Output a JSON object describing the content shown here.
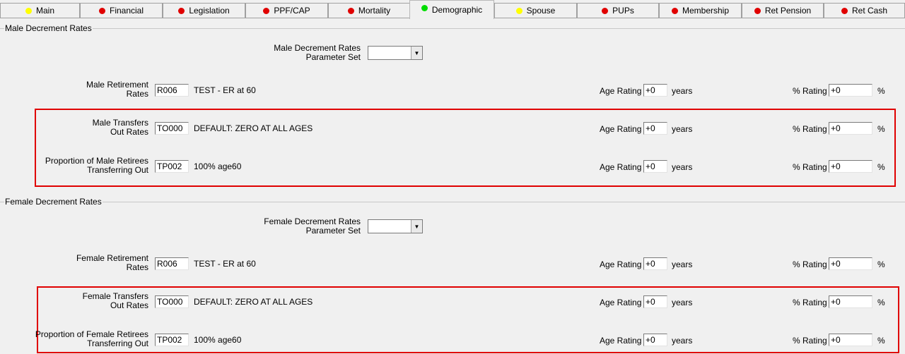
{
  "tabs": [
    {
      "label": "Main",
      "color": "#ffff00"
    },
    {
      "label": "Financial",
      "color": "#e00000"
    },
    {
      "label": "Legislation",
      "color": "#e00000"
    },
    {
      "label": "PPF/CAP",
      "color": "#e00000"
    },
    {
      "label": "Mortality",
      "color": "#e00000"
    },
    {
      "label": "Demographic",
      "color": "#00dd00"
    },
    {
      "label": "Spouse",
      "color": "#ffff00"
    },
    {
      "label": "PUPs",
      "color": "#e00000"
    },
    {
      "label": "Membership",
      "color": "#e00000"
    },
    {
      "label": "Ret Pension",
      "color": "#e00000"
    },
    {
      "label": "Ret Cash",
      "color": "#e00000"
    }
  ],
  "male": {
    "legend": "Male Decrement Rates",
    "param_label_1": "Male Decrement Rates",
    "param_label_2": "Parameter Set",
    "param_value": "",
    "rows": [
      {
        "label1": "Male Retirement",
        "label2": "Rates",
        "code": "R006",
        "desc": "TEST - ER at 60",
        "age_label": "Age Rating",
        "age_value": "+0",
        "age_unit": "years",
        "pct_label": "% Rating",
        "pct_value": "+0",
        "pct_unit": "%"
      },
      {
        "label1": "Male Transfers",
        "label2": "Out Rates",
        "code": "TO000",
        "desc": "DEFAULT:  ZERO AT ALL AGES",
        "age_label": "Age Rating",
        "age_value": "+0",
        "age_unit": "years",
        "pct_label": "% Rating",
        "pct_value": "+0",
        "pct_unit": "%"
      },
      {
        "label1": "Proportion of Male Retirees",
        "label2": "Transferring Out",
        "code": "TP002",
        "desc": "100% age60",
        "age_label": "Age Rating",
        "age_value": "+0",
        "age_unit": "years",
        "pct_label": "% Rating",
        "pct_value": "+0",
        "pct_unit": "%"
      }
    ]
  },
  "female": {
    "legend": "Female Decrement Rates",
    "param_label_1": "Female Decrement Rates",
    "param_label_2": "Parameter Set",
    "param_value": "",
    "rows": [
      {
        "label1": "Female Retirement",
        "label2": "Rates",
        "code": "R006",
        "desc": "TEST - ER at 60",
        "age_label": "Age Rating",
        "age_value": "+0",
        "age_unit": "years",
        "pct_label": "% Rating",
        "pct_value": "+0",
        "pct_unit": "%"
      },
      {
        "label1": "Female Transfers",
        "label2": "Out Rates",
        "code": "TO000",
        "desc": "DEFAULT:  ZERO AT ALL AGES",
        "age_label": "Age Rating",
        "age_value": "+0",
        "age_unit": "years",
        "pct_label": "% Rating",
        "pct_value": "+0",
        "pct_unit": "%"
      },
      {
        "label1": "Proportion of Female Retirees",
        "label2": "Transferring Out",
        "code": "TP002",
        "desc": "100% age60",
        "age_label": "Age Rating",
        "age_value": "+0",
        "age_unit": "years",
        "pct_label": "% Rating",
        "pct_value": "+0",
        "pct_unit": "%"
      }
    ]
  }
}
